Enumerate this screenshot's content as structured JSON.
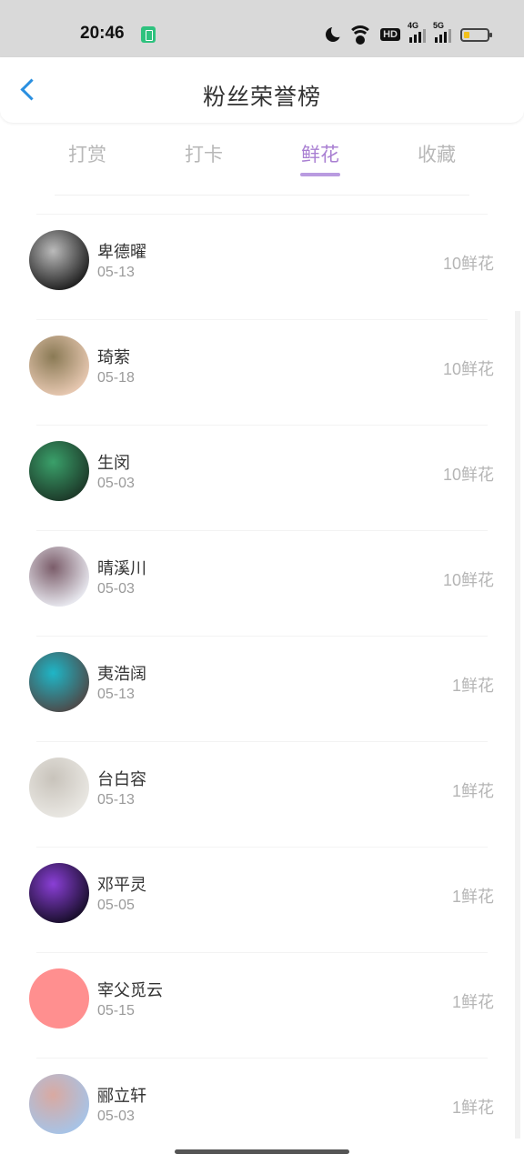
{
  "status": {
    "time": "20:46",
    "hd": "HD",
    "sig1": "4G",
    "sig2": "5G"
  },
  "header": {
    "title": "粉丝荣誉榜"
  },
  "tabs": [
    {
      "label": "打赏"
    },
    {
      "label": "打卡"
    },
    {
      "label": "鲜花",
      "active": true
    },
    {
      "label": "收藏"
    }
  ],
  "list": [
    {
      "name": "卑德曜",
      "date": "05-13",
      "value": "10鲜花",
      "avatar": [
        "#222",
        "#bbb"
      ]
    },
    {
      "name": "琦萦",
      "date": "05-18",
      "value": "10鲜花",
      "avatar": [
        "#e6c7b0",
        "#8a7a55"
      ]
    },
    {
      "name": "生闵",
      "date": "05-03",
      "value": "10鲜花",
      "avatar": [
        "#1d3b2a",
        "#3aa06a"
      ]
    },
    {
      "name": "晴溪川",
      "date": "05-03",
      "value": "10鲜花",
      "avatar": [
        "#e7e7ee",
        "#7b5d6a"
      ]
    },
    {
      "name": "夷浩阔",
      "date": "05-13",
      "value": "1鲜花",
      "avatar": [
        "#4c4c4c",
        "#1fb6c7"
      ]
    },
    {
      "name": "台白容",
      "date": "05-13",
      "value": "1鲜花",
      "avatar": [
        "#e9e7e2",
        "#c8c3bb"
      ]
    },
    {
      "name": "邓平灵",
      "date": "05-05",
      "value": "1鲜花",
      "avatar": [
        "#1a0f2e",
        "#8a3fd6"
      ]
    },
    {
      "name": "宰父觅云",
      "date": "05-15",
      "value": "1鲜花",
      "avatar": [
        "#ff8f8f",
        "#ff8f8f"
      ]
    },
    {
      "name": "郦立轩",
      "date": "05-03",
      "value": "1鲜花",
      "avatar": [
        "#a7c3e6",
        "#d9a9a1"
      ]
    }
  ]
}
